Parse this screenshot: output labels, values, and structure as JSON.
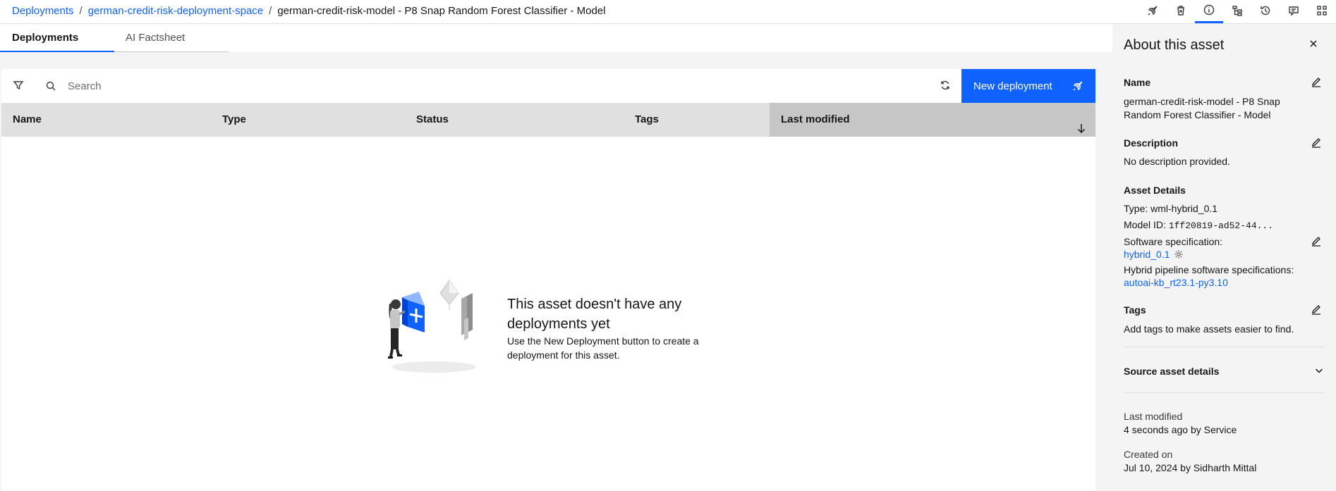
{
  "breadcrumb": {
    "root": "Deployments",
    "space": "german-credit-risk-deployment-space",
    "current": "german-credit-risk-model - P8 Snap Random Forest Classifier - Model",
    "separator": "/"
  },
  "tabs": [
    {
      "label": "Deployments",
      "active": true
    },
    {
      "label": "AI Factsheet",
      "active": false
    }
  ],
  "toolbar": {
    "icons": [
      "rocket-icon",
      "trash-icon",
      "info-icon",
      "lineage-icon",
      "history-icon",
      "comment-icon",
      "apps-icon"
    ],
    "active": "info-icon"
  },
  "search": {
    "placeholder": "Search"
  },
  "new_deployment_label": "New deployment",
  "table": {
    "columns": [
      "Name",
      "Type",
      "Status",
      "Tags",
      "Last modified"
    ],
    "sorted_column": "Last modified",
    "sort_direction": "descending"
  },
  "empty_state": {
    "title": "This asset doesn't have any deployments yet",
    "description": "Use the New Deployment button to create a deployment for this asset."
  },
  "panel": {
    "title": "About this asset",
    "name_label": "Name",
    "name_value": "german-credit-risk-model - P8 Snap Random Forest Classifier - Model",
    "description_label": "Description",
    "description_value": "No description provided.",
    "asset_details_label": "Asset Details",
    "type_label": "Type:",
    "type_value": "wml-hybrid_0.1",
    "model_id_label": "Model ID:",
    "model_id_value": "1ff20819-ad52-44...",
    "software_spec_label": "Software specification:",
    "software_spec_value": "hybrid_0.1",
    "hybrid_spec_label": "Hybrid pipeline software specifications:",
    "hybrid_spec_value": "autoai-kb_rt23.1-py3.10",
    "tags_label": "Tags",
    "tags_value": "Add tags to make assets easier to find.",
    "source_label": "Source asset details",
    "last_modified_label": "Last modified",
    "last_modified_value": "4 seconds ago by Service",
    "created_label": "Created on",
    "created_value": "Jul 10, 2024 by Sidharth Mittal"
  },
  "colors": {
    "accent": "#0f62fe",
    "header_bg": "#e0e0e0",
    "panel_bg": "#f4f4f4"
  }
}
